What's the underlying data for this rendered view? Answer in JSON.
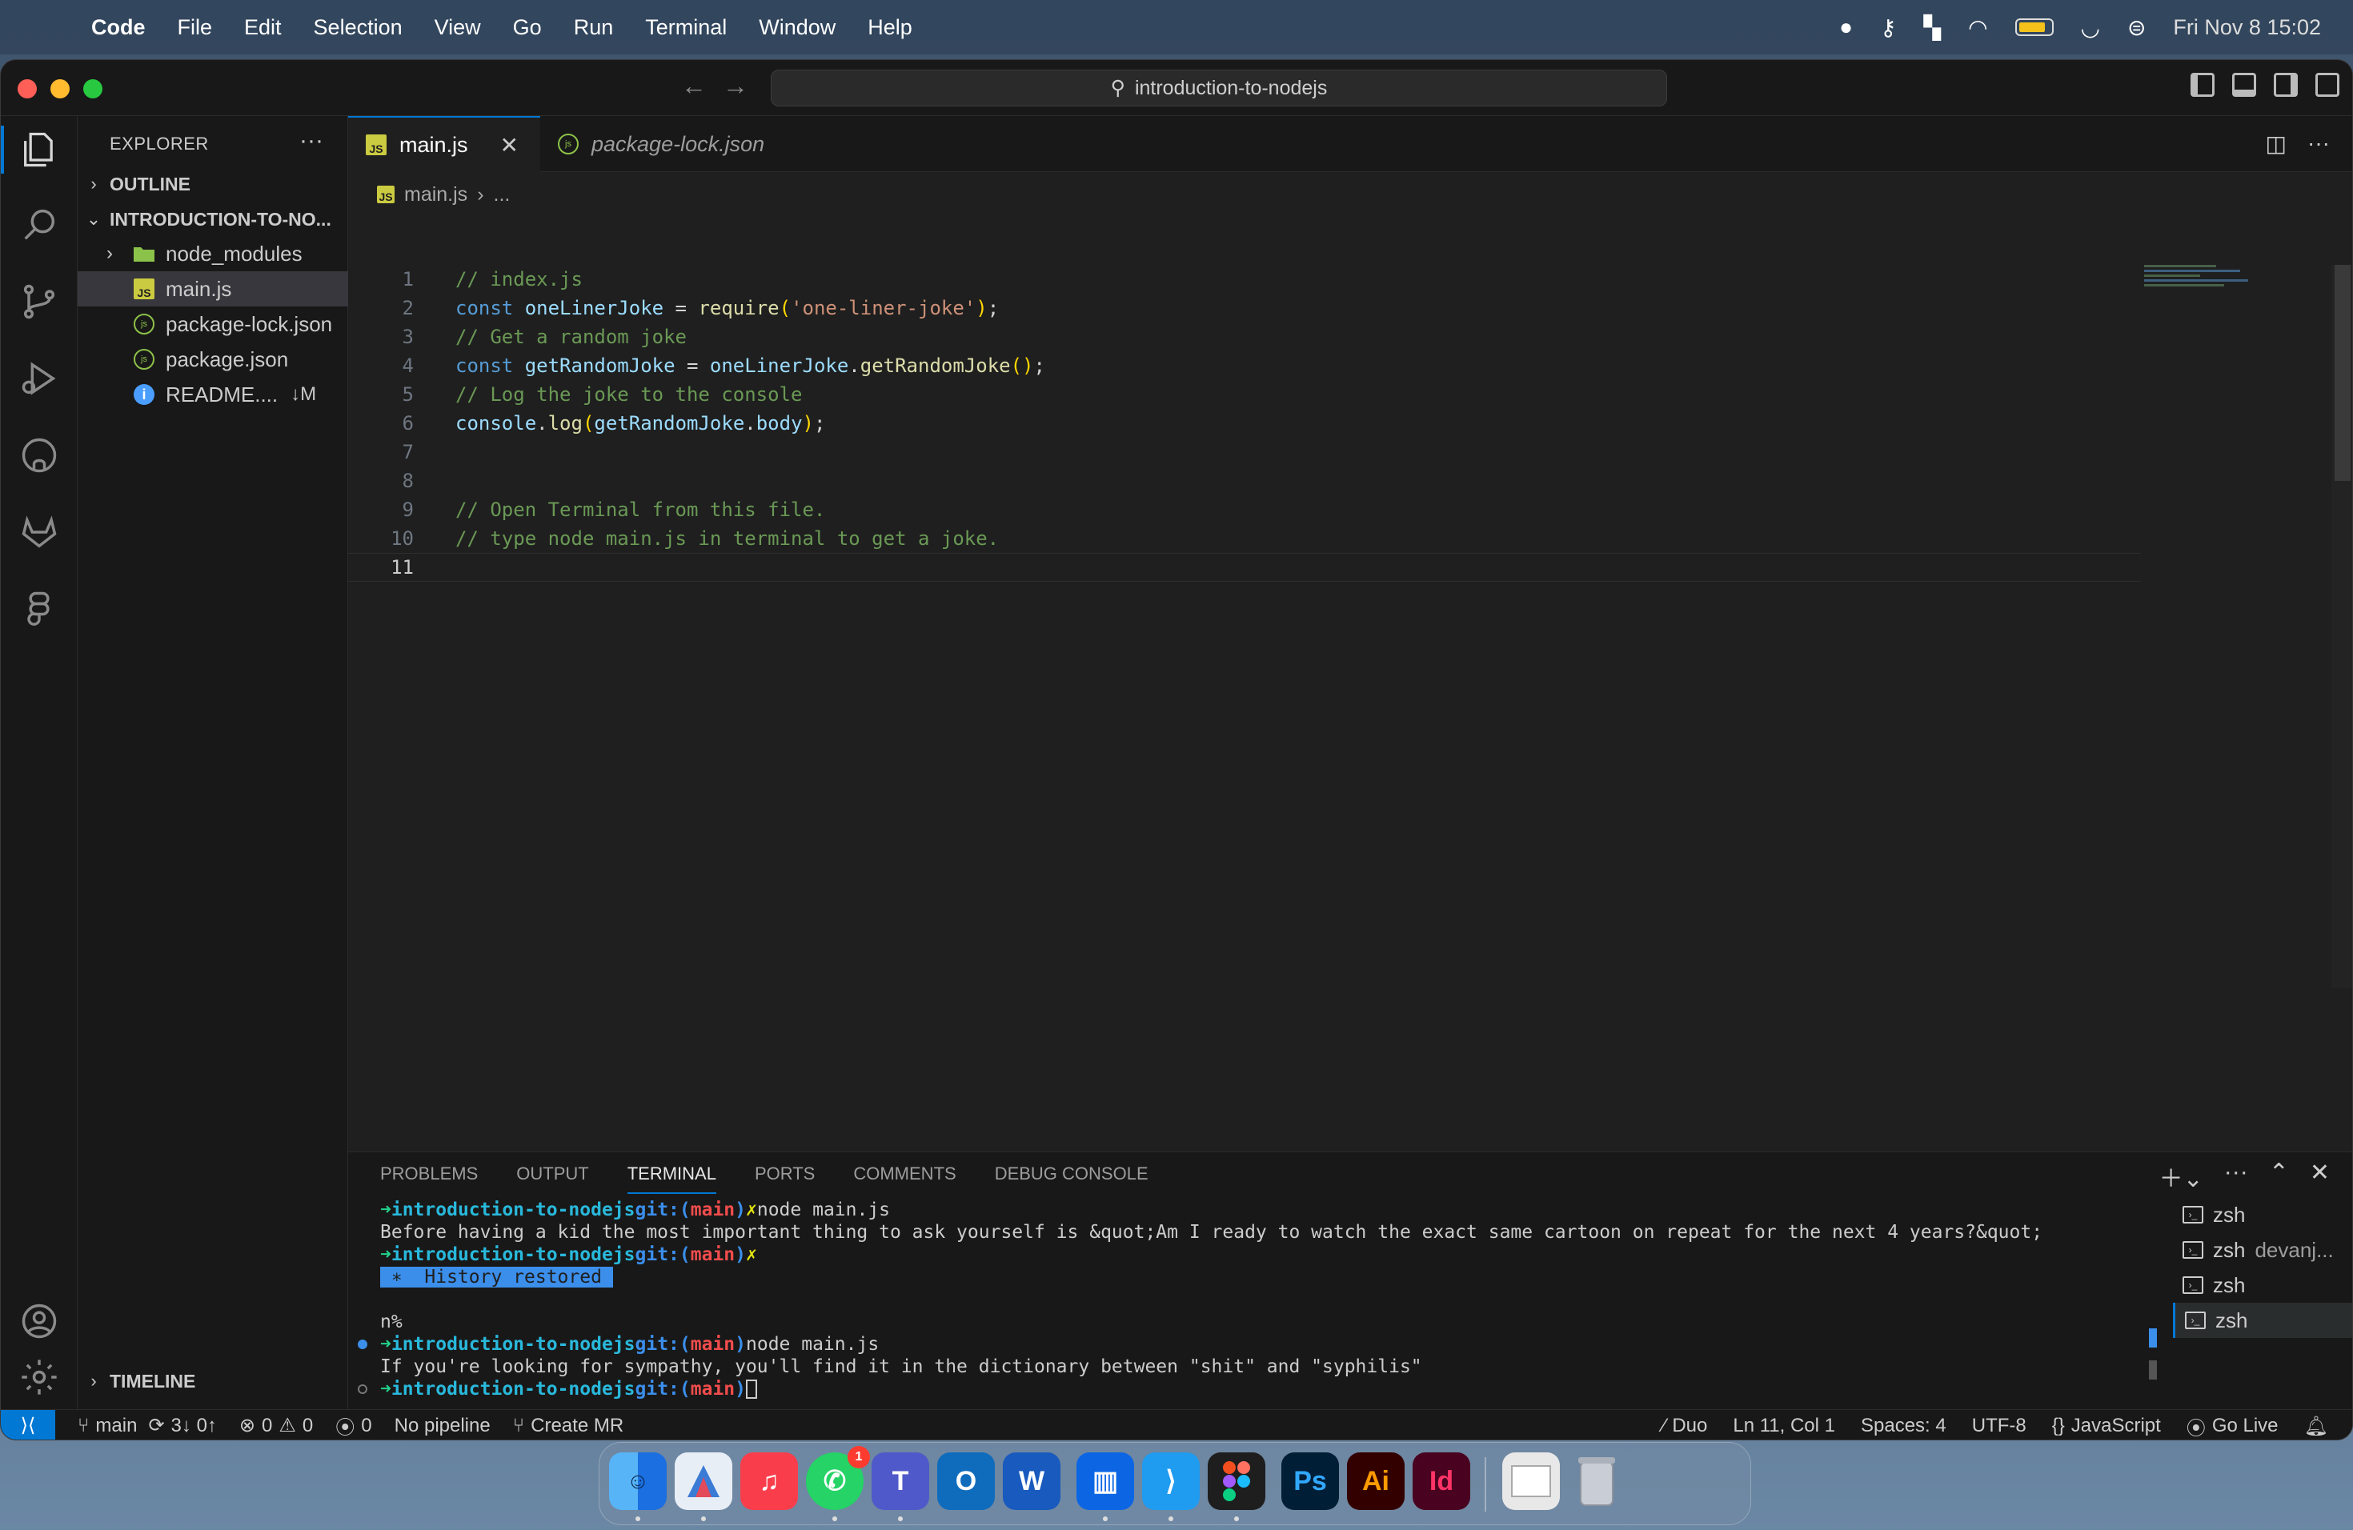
{
  "menubar": {
    "app": "Code",
    "items": [
      "File",
      "Edit",
      "Selection",
      "View",
      "Go",
      "Run",
      "Terminal",
      "Window",
      "Help"
    ],
    "clock": "Fri Nov 8  15:02"
  },
  "window": {
    "search": "introduction-to-nodejs"
  },
  "sidebar": {
    "title": "EXPLORER",
    "outline": "OUTLINE",
    "project": "INTRODUCTION-TO-NO...",
    "files": [
      {
        "name": "node_modules",
        "icon": "folder-icon"
      },
      {
        "name": "main.js",
        "icon": "js-file-icon"
      },
      {
        "name": "package-lock.json",
        "icon": "json-file-icon"
      },
      {
        "name": "package.json",
        "icon": "json-file-icon"
      },
      {
        "name": "README....",
        "icon": "info-icon",
        "badge": "↓M"
      }
    ],
    "timeline": "TIMELINE"
  },
  "tabs": [
    {
      "label": "main.js"
    },
    {
      "label": "package-lock.json"
    }
  ],
  "breadcrumb": {
    "file": "main.js",
    "rest": "..."
  },
  "code": {
    "line_numbers": [
      "1",
      "2",
      "3",
      "4",
      "5",
      "6",
      "7",
      "8",
      "9",
      "10",
      "11"
    ],
    "l1": "// index.js",
    "l2_kw": "const ",
    "l2_var": "oneLinerJoke",
    "l2_eq": " = ",
    "l2_fn": "require",
    "l2_str": "'one-liner-joke'",
    "l2_end": ";",
    "l3": "// Get a random joke",
    "l4_kw": "const ",
    "l4_var": "getRandomJoke",
    "l4_eq": " = ",
    "l4_obj": "oneLinerJoke",
    "l4_dot": ".",
    "l4_fn": "getRandomJoke",
    "l4_end": ";",
    "l5": "// Log the joke to the console",
    "l6_obj": "console",
    "l6_dot": ".",
    "l6_fn": "log",
    "l6_arg": "getRandomJoke",
    "l6_dot2": ".",
    "l6_prop": "body",
    "l6_end": ";",
    "l9": "// Open Terminal from this file.",
    "l10": "// type node main.js in terminal to get a joke."
  },
  "panel": {
    "tabs": [
      "PROBLEMS",
      "OUTPUT",
      "TERMINAL",
      "PORTS",
      "COMMENTS",
      "DEBUG CONSOLE"
    ],
    "terminal": {
      "arrow": "➜",
      "dir": "introduction-to-nodejs",
      "git": "git:(",
      "branch": "main",
      "git_close": ")",
      "x": "✗",
      "cmd": "node main.js",
      "joke1": "Before having a kid the most important thing to ask yourself is &quot;Am I ready to watch the exact same cartoon on repeat for the next 4 years?&quot;",
      "history": " ∗  History restored ",
      "stray": "n%",
      "joke2": "If you're looking for sympathy, you'll find it in the dictionary between \"shit\" and \"syphilis\""
    },
    "terminals": [
      {
        "name": "zsh",
        "sub": ""
      },
      {
        "name": "zsh",
        "sub": "devanj..."
      },
      {
        "name": "zsh",
        "sub": ""
      },
      {
        "name": "zsh",
        "sub": ""
      }
    ]
  },
  "status": {
    "branch": "main",
    "sync": "3↓ 0↑",
    "errors": "0",
    "warnings": "0",
    "ports": "0",
    "pipeline": "No pipeline",
    "mr": "Create MR",
    "duo": "Duo",
    "position": "Ln 11, Col 1",
    "spaces": "Spaces: 4",
    "encoding": "UTF-8",
    "language": "JavaScript",
    "golive": "Go Live"
  },
  "dock": {
    "apps": [
      {
        "name": "finder",
        "label": "",
        "color": "#2a7be4"
      },
      {
        "name": "affinity",
        "label": "",
        "color": "#5a6fa8"
      },
      {
        "name": "music",
        "label": "♫",
        "color": "#fa3d4b"
      },
      {
        "name": "whatsapp",
        "label": "✆",
        "color": "#25d366",
        "badge": "1"
      },
      {
        "name": "teams",
        "label": "T",
        "color": "#5059c9"
      },
      {
        "name": "outlook",
        "label": "O",
        "color": "#0f6cbd"
      },
      {
        "name": "word",
        "label": "W",
        "color": "#185abd"
      },
      {
        "name": "trello",
        "label": "▥",
        "color": "#0c66e4"
      },
      {
        "name": "vscode",
        "label": "⟩",
        "color": "#1f9cf0"
      },
      {
        "name": "figma",
        "label": "✦",
        "color": "#1e1e1e"
      },
      {
        "name": "photoshop",
        "label": "Ps",
        "color": "#001e36"
      },
      {
        "name": "illustrator",
        "label": "Ai",
        "color": "#330000"
      },
      {
        "name": "indesign",
        "label": "Id",
        "color": "#49021f"
      },
      {
        "name": "preview",
        "label": "",
        "color": "#e8e8e8"
      },
      {
        "name": "trash",
        "label": "",
        "color": "#9aa3ad"
      }
    ]
  }
}
